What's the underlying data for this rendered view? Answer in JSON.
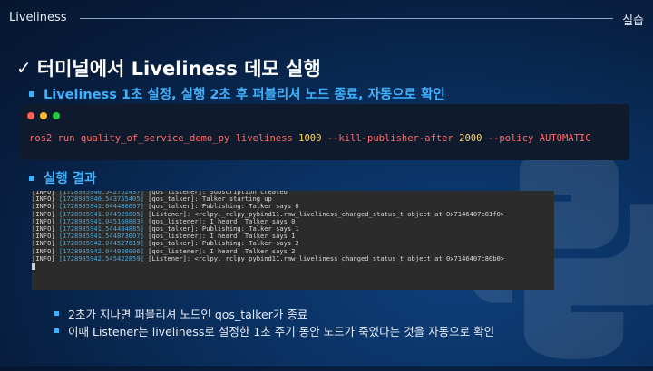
{
  "header": {
    "title": "Liveliness",
    "section": "실습"
  },
  "slide": {
    "title": "터미널에서 Liveliness 데모 실행",
    "bullet1": "Liveliness 1초 설정, 실행 2초 후 퍼블리셔 노드 종료, 자동으로 확인",
    "command": {
      "p1": "ros2 run quality_of_service_demo_py liveliness ",
      "n1": "1000",
      "p2": " --kill-publisher-after ",
      "n2": "2000",
      "p3": " --policy AUTOMATIC"
    },
    "bullet2": "실행 결과",
    "log": [
      {
        "tag": "[INFO] ",
        "ts": "[1728985940.542752437]",
        "msg": " [qos_listener]: Subscription created"
      },
      {
        "tag": "[INFO] ",
        "ts": "[1728985940.543755405]",
        "msg": " [qos_talker]: Talker starting up"
      },
      {
        "tag": "[INFO] ",
        "ts": "[1728985941.044486097]",
        "msg": " [qos_talker]: Publishing: Talker says 0"
      },
      {
        "tag": "[INFO] ",
        "ts": "[1728985941.044929605]",
        "msg": " [Listener]: <rclpy._rclpy_pybind11.rmw_liveliness_changed_status_t object at 0x7146407c81f0>"
      },
      {
        "tag": "[INFO] ",
        "ts": "[1728985941.045160883]",
        "msg": " [qos_listener]: I heard: Talker says 0"
      },
      {
        "tag": "[INFO] ",
        "ts": "[1728985941.544484885]",
        "msg": " [qos_talker]: Publishing: Talker says 1"
      },
      {
        "tag": "[INFO] ",
        "ts": "[1728985941.544873007]",
        "msg": " [qos_listener]: I heard: Talker says 1"
      },
      {
        "tag": "[INFO] ",
        "ts": "[1728985942.044527619]",
        "msg": " [qos_talker]: Publishing: Talker says 2"
      },
      {
        "tag": "[INFO] ",
        "ts": "[1728985942.044920006]",
        "msg": " [qos_listener]: I heard: Talker says 2"
      },
      {
        "tag": "[INFO] ",
        "ts": "[1728985942.545422859]",
        "msg": " [Listener]: <rclpy._rclpy_pybind11.rmw_liveliness_changed_status_t object at 0x7146407c80b0>"
      }
    ],
    "sub_bullets": [
      "2초가 지나면 퍼블리셔 노드인 qos_talker가 종료",
      "이때 Listener는 liveliness로 설정한 1초 주기 동안 노드가 죽었다는 것을 자동으로 확인"
    ]
  },
  "colors": {
    "accent": "#3fb2ff",
    "command_text": "#ff6b6b",
    "command_number": "#ffd56b"
  }
}
